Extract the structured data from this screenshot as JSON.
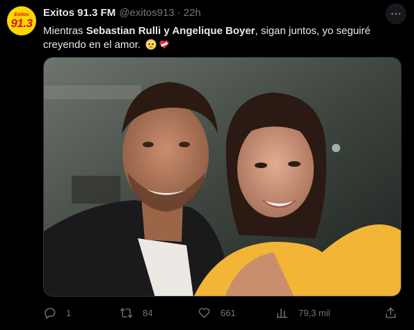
{
  "account": {
    "avatar_text_top": "Exitos",
    "avatar_text_main": "91.3",
    "name": "Exitos 91.3 FM",
    "handle": "@exitos913",
    "separator": "·",
    "time": "22h"
  },
  "tweet": {
    "text_before": "Mientras ",
    "text_bold": "Sebastian Rulli y Angelique Boyer",
    "text_after": ", sigan juntos, yo seguiré creyendo en el amor.",
    "emojis": [
      "pleading-face-emoji",
      "mending-heart-emoji"
    ]
  },
  "photo": {
    "icon": "photo-couple-selfie"
  },
  "actions": {
    "reply": {
      "icon": "reply-icon",
      "count": "1"
    },
    "retweet": {
      "icon": "retweet-icon",
      "count": "84"
    },
    "like": {
      "icon": "like-icon",
      "count": "661"
    },
    "views": {
      "icon": "views-icon",
      "count": "79,3 mil"
    },
    "share": {
      "icon": "share-icon"
    }
  },
  "colors": {
    "background": "#000000",
    "text": "#e7e9ea",
    "muted": "#71767b",
    "avatar_bg": "#ffd600",
    "avatar_text": "#d2121b"
  }
}
